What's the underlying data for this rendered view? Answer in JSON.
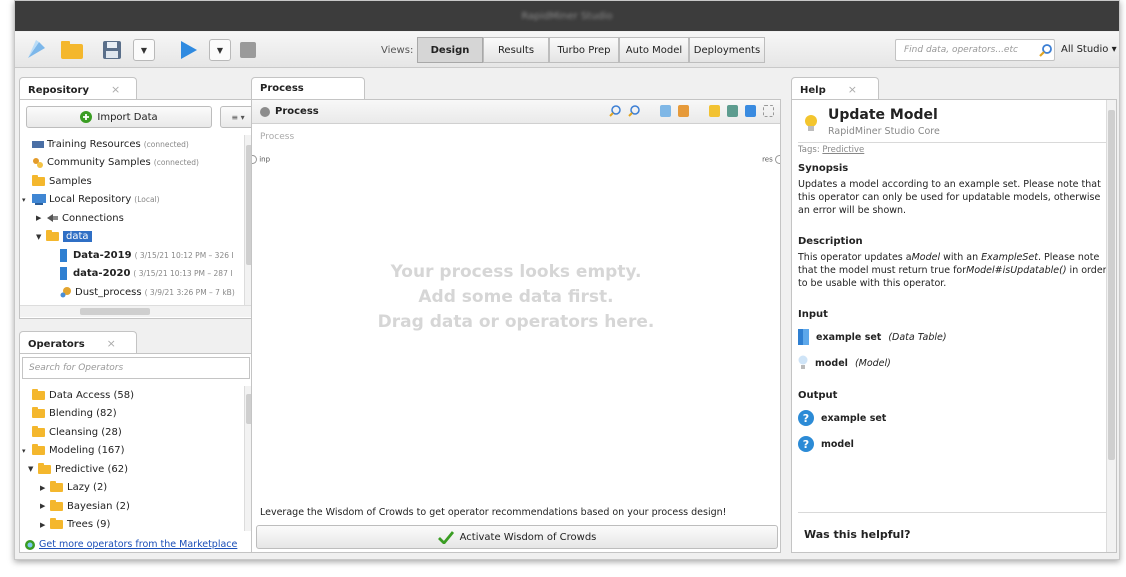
{
  "window": {
    "title": "RapidMiner Studio"
  },
  "toolbar": {
    "views_label": "Views:",
    "views": [
      "Design",
      "Results",
      "Turbo Prep",
      "Auto Model",
      "Deployments"
    ],
    "active_view": "Design",
    "search_placeholder": "Find data, operators...etc",
    "studio_selector": "All Studio ▾"
  },
  "repository": {
    "tab_label": "Repository",
    "close_label": "×",
    "import_label": "Import Data",
    "menu_label": "≡ ▾",
    "items": [
      {
        "label": "Training Resources",
        "sub": "(connected)",
        "icon": "training-resources-icon",
        "indent": 0,
        "arrow": ""
      },
      {
        "label": "Community Samples",
        "sub": "(connected)",
        "icon": "community-samples-icon",
        "indent": 0,
        "arrow": ""
      },
      {
        "label": "Samples",
        "sub": "",
        "icon": "folder-icon",
        "indent": 0,
        "arrow": ""
      },
      {
        "label": "Local Repository",
        "sub": "(Local)",
        "icon": "local-repository-icon",
        "indent": 0,
        "arrow": "▾"
      },
      {
        "label": "Connections",
        "sub": "",
        "icon": "connections-icon",
        "indent": 1,
        "arrow": "▶"
      },
      {
        "label": "data",
        "sub": "",
        "icon": "folder-icon",
        "indent": 1,
        "arrow": "▼",
        "selected": true
      },
      {
        "label": "Data-2019",
        "sub": "( 3/15/21 10:12 PM – 326 I",
        "icon": "data-table-icon",
        "indent": 2,
        "arrow": "",
        "bold": true
      },
      {
        "label": "data-2020",
        "sub": "( 3/15/21 10:13 PM – 287 I",
        "icon": "data-table-icon",
        "indent": 2,
        "arrow": "",
        "bold": true
      },
      {
        "label": "Dust_process",
        "sub": "( 3/9/21 3:26 PM – 7 kB)",
        "icon": "process-icon",
        "indent": 2,
        "arrow": ""
      }
    ]
  },
  "operators": {
    "tab_label": "Operators",
    "close_label": "×",
    "search_placeholder": "Search for Operators",
    "items": [
      {
        "label": "Data Access (58)",
        "indent": 0,
        "arrow": ""
      },
      {
        "label": "Blending (82)",
        "indent": 0,
        "arrow": ""
      },
      {
        "label": "Cleansing (28)",
        "indent": 0,
        "arrow": ""
      },
      {
        "label": "Modeling (167)",
        "indent": 0,
        "arrow": "▾"
      },
      {
        "label": "Predictive (62)",
        "indent": 1,
        "arrow": "▼"
      },
      {
        "label": "Lazy (2)",
        "indent": 2,
        "arrow": "▶"
      },
      {
        "label": "Bayesian (2)",
        "indent": 2,
        "arrow": "▶"
      },
      {
        "label": "Trees (9)",
        "indent": 2,
        "arrow": "▶"
      }
    ],
    "marketplace_link": "Get more operators from the Marketplace"
  },
  "process": {
    "tab_label": "Process",
    "header_label": "Process",
    "breadcrumb": "Process",
    "port_in": "inp",
    "port_out": "res",
    "empty_lines": [
      "Your process looks empty.",
      "Add some data first.",
      "Drag data or operators here."
    ],
    "woc_text": "Leverage the Wisdom of Crowds to get operator recommendations based on your process design!",
    "woc_button": "Activate Wisdom of Crowds"
  },
  "help": {
    "tab_label": "Help",
    "close_label": "×",
    "title": "Update Model",
    "subtitle": "RapidMiner Studio Core",
    "tags_label": "Tags:",
    "tags_value": "Predictive",
    "synopsis_heading": "Synopsis",
    "synopsis_text": "Updates a model according to an example set. Please note that this operator can only be used for updatable models, otherwise an error will be shown.",
    "description_heading": "Description",
    "description_text_1": "This operator updates a",
    "description_model": "Model",
    "description_text_2": " with an ",
    "description_exset": "ExampleSet",
    "description_text_3": ". Please note that the model must return true for",
    "description_method": "Model#isUpdatable()",
    "description_text_4": " in order to be usable with this operator.",
    "input_heading": "Input",
    "inputs": [
      {
        "name": "example set",
        "type": "(Data Table)"
      },
      {
        "name": "model",
        "type": "(Model)"
      }
    ],
    "output_heading": "Output",
    "outputs": [
      {
        "name": "example set"
      },
      {
        "name": "model"
      }
    ],
    "helpful_label": "Was this helpful?"
  },
  "colors": {
    "accent_blue": "#2c8bd6",
    "folder_yellow": "#f4b72d",
    "link_blue": "#1b4fb8",
    "check_green": "#3a9d23"
  }
}
